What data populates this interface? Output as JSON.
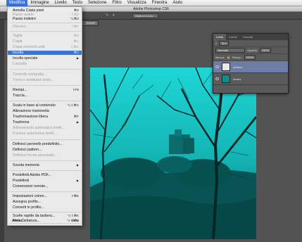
{
  "menubar": {
    "items": [
      "Modifica",
      "Immagine",
      "Livello",
      "Testo",
      "Selezione",
      "Filtro",
      "Visualizza",
      "Finestra",
      "Aiuto"
    ],
    "active": "Modifica"
  },
  "title": "Adobe Photoshop CS6",
  "options_bar": {
    "button_label": "Migliora bordo..."
  },
  "document_tab": {
    "label": "RGB/8*"
  },
  "menu": {
    "items": [
      {
        "label": "Annulla Copia pixel",
        "shortcut": "⌘Z",
        "disabled": false
      },
      {
        "label": "Passo avanti",
        "shortcut": "⇧⌘Z",
        "disabled": true
      },
      {
        "label": "Passo indietro",
        "shortcut": "⌥⌘Z",
        "disabled": false
      },
      {
        "label": "Dissolvi...",
        "shortcut": "⇧⌘F",
        "disabled": true
      },
      {
        "label": "Taglia",
        "shortcut": "⌘X",
        "disabled": true
      },
      {
        "label": "Copia",
        "shortcut": "⌘C",
        "disabled": true
      },
      {
        "label": "Copia elementi uniti",
        "shortcut": "⇧⌘C",
        "disabled": true
      },
      {
        "label": "Incolla",
        "shortcut": "⌘V",
        "disabled": false,
        "highlighted": true
      },
      {
        "label": "Incolla speciale",
        "submenu": true,
        "disabled": false
      },
      {
        "label": "Cancella",
        "disabled": true
      },
      {
        "label": "Controllo ortografia...",
        "disabled": true
      },
      {
        "label": "Trova e sostituisci testo...",
        "disabled": true
      },
      {
        "label": "Riempi...",
        "shortcut": "⇧F5",
        "disabled": false
      },
      {
        "label": "Traccia...",
        "disabled": false
      },
      {
        "label": "Scala in base al contenuto",
        "shortcut": "⌥⇧⌘C",
        "disabled": false
      },
      {
        "label": "Alterazione marionetta",
        "disabled": false
      },
      {
        "label": "Trasformazione libera",
        "shortcut": "⌘T",
        "disabled": false
      },
      {
        "label": "Trasforma",
        "submenu": true,
        "disabled": false
      },
      {
        "label": "Allineamento automatico livelli...",
        "disabled": true
      },
      {
        "label": "Fusione automatica livelli...",
        "disabled": true
      },
      {
        "label": "Definisci pennello predefinito...",
        "disabled": false
      },
      {
        "label": "Definisci pattern...",
        "disabled": false
      },
      {
        "label": "Definisci forma personale...",
        "disabled": true
      },
      {
        "label": "Svuota memoria",
        "submenu": true,
        "disabled": false
      },
      {
        "label": "Predefiniti Adobe PDF...",
        "disabled": false
      },
      {
        "label": "Predefiniti",
        "submenu": true,
        "disabled": false
      },
      {
        "label": "Connessioni remote...",
        "disabled": false
      },
      {
        "label": "Impostazioni colore...",
        "shortcut": "⇧⌘K",
        "disabled": false
      },
      {
        "label": "Assegna profilo...",
        "disabled": false
      },
      {
        "label": "Converti in profilo...",
        "disabled": false
      },
      {
        "label": "Scelte rapide da tastiera...",
        "shortcut": "⌥⇧⌘K",
        "disabled": false
      },
      {
        "label": "Menu...",
        "shortcut": "⌥⇧⌘M",
        "disabled": false
      },
      {
        "label": "Avvia Dettatura...",
        "shortcut": "fn fn",
        "disabled": false
      }
    ]
  },
  "layers_panel": {
    "tabs": [
      "Livelli",
      "Canali",
      "Tracciati"
    ],
    "filter_label": "Tipo",
    "blend_mode": "Normale",
    "opacity_label": "Opacità:",
    "opacity_value": "100%",
    "lock_label": "Blocca:",
    "fill_label": "Riemp.:",
    "fill_value": "100%",
    "layers": [
      {
        "name": "sinistra",
        "selected": true
      },
      {
        "name": "destra",
        "selected": false
      }
    ]
  },
  "colors": {
    "menu_highlight": "#3a74d9",
    "canvas_tint": "#12c8c8",
    "layer_selected": "#6c7ea6"
  }
}
